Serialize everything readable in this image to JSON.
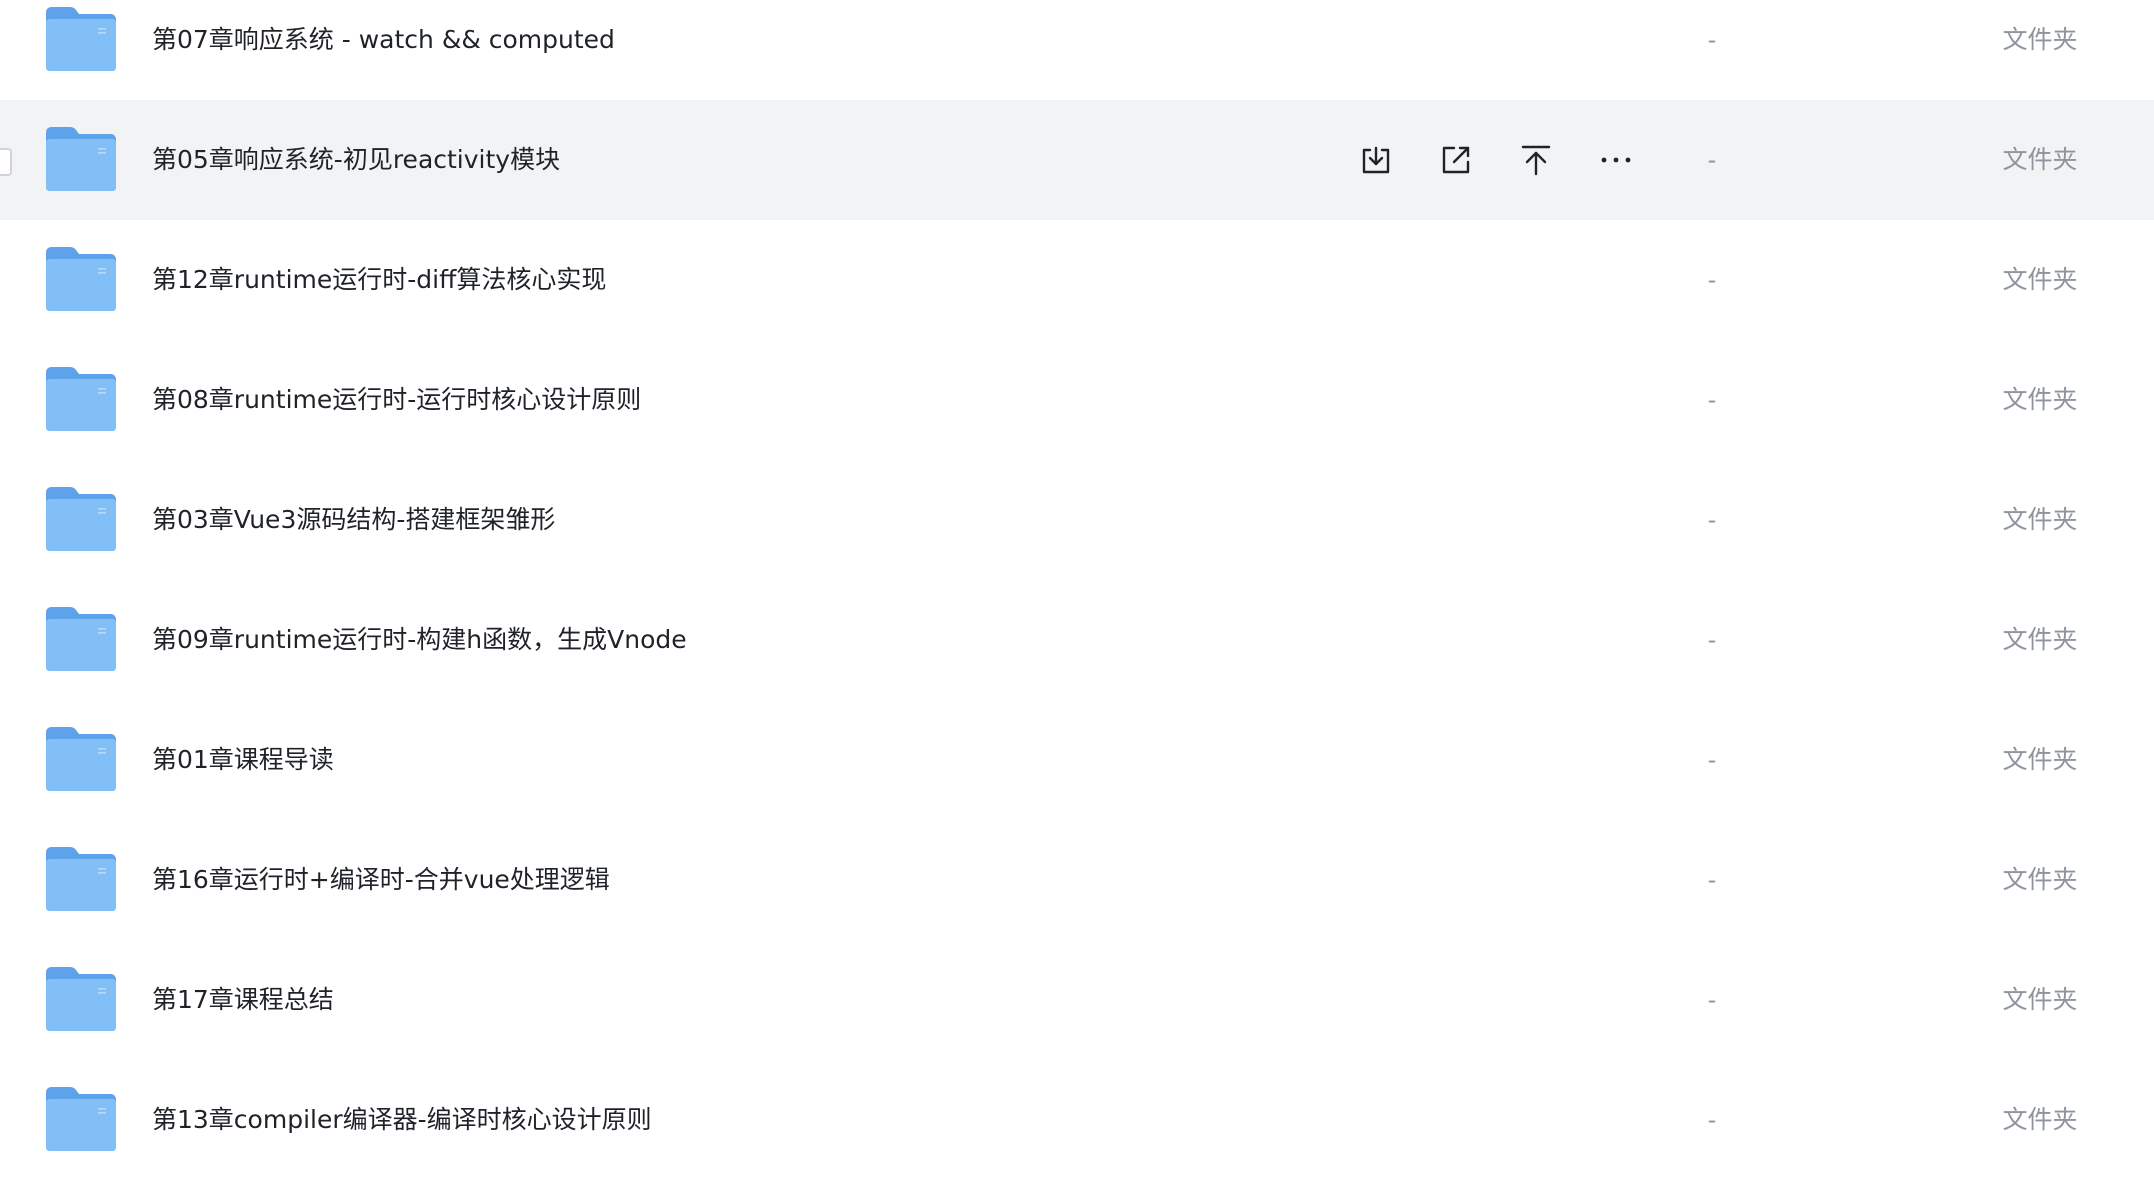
{
  "file_list": {
    "rows": [
      {
        "name": "第07章响应系统 - watch && computed",
        "size": "-",
        "type": "文件夹"
      },
      {
        "name": "第05章响应系统-初见reactivity模块",
        "size": "-",
        "type": "文件夹"
      },
      {
        "name": "第12章runtime运行时-diff算法核心实现",
        "size": "-",
        "type": "文件夹"
      },
      {
        "name": "第08章runtime运行时-运行时核心设计原则",
        "size": "-",
        "type": "文件夹"
      },
      {
        "name": "第03章Vue3源码结构-搭建框架雏形",
        "size": "-",
        "type": "文件夹"
      },
      {
        "name": "第09章runtime运行时-构建h函数，生成Vnode",
        "size": "-",
        "type": "文件夹"
      },
      {
        "name": "第01章课程导读",
        "size": "-",
        "type": "文件夹"
      },
      {
        "name": "第16章运行时+编译时-合并vue处理逻辑",
        "size": "-",
        "type": "文件夹"
      },
      {
        "name": "第17章课程总结",
        "size": "-",
        "type": "文件夹"
      },
      {
        "name": "第13章compiler编译器-编译时核心设计原则",
        "size": "-",
        "type": "文件夹"
      }
    ],
    "hovered_row_actions": [
      {
        "icon": "download-icon"
      },
      {
        "icon": "share-icon"
      },
      {
        "icon": "move-to-top-icon"
      },
      {
        "icon": "more-icon"
      }
    ]
  },
  "colors": {
    "folder_back": "#5ea2ea",
    "folder_front": "#82bff6",
    "hover_background": "#f2f3f5",
    "secondary_text": "#8f959e",
    "primary_text": "#1f2329"
  }
}
